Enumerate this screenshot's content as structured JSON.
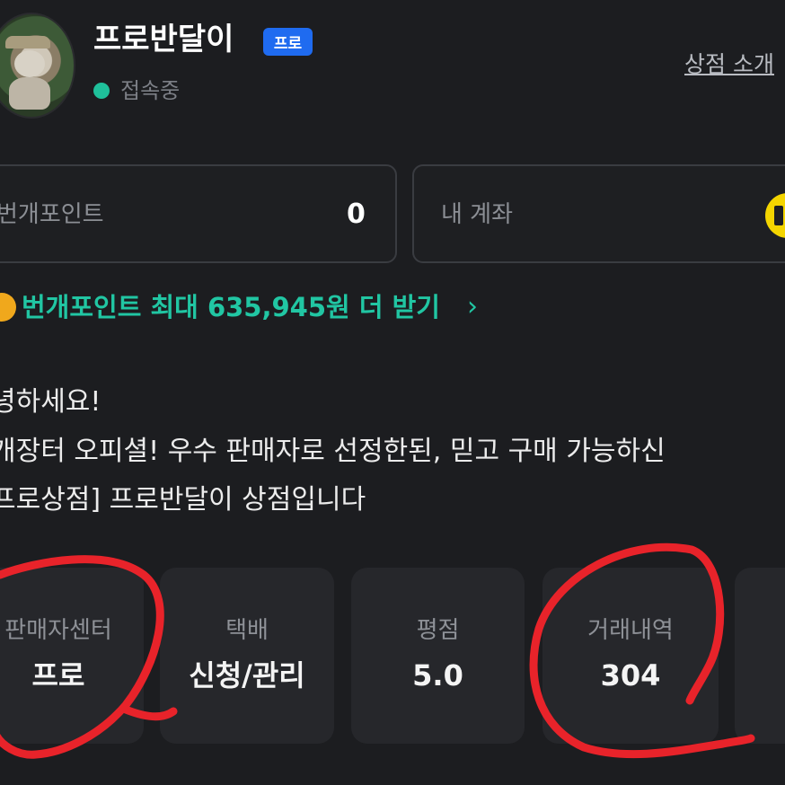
{
  "header": {
    "shop_name": "프로반달이",
    "badge": "프로",
    "status": "접속중",
    "shop_intro_link": "상점 소개"
  },
  "wallet": {
    "points_label": "번개포인트",
    "points_value": "0",
    "account_label": "내 계좌"
  },
  "promo": {
    "text": "번개포인트 최대 635,945원 더 받기",
    "chevron": "›"
  },
  "intro_lines": [
    "녕하세요!",
    "개장터 오피셜! 우수 판매자로 선정한된, 믿고 구매 가능하신",
    "프로상점] 프로반달이 상점입니다"
  ],
  "stats": [
    {
      "label": "판매자센터",
      "value": "프로"
    },
    {
      "label": "택배",
      "value": "신청/관리"
    },
    {
      "label": "평점",
      "value": "5.0"
    },
    {
      "label": "거래내역",
      "value": "304"
    }
  ],
  "colors": {
    "background": "#1c1d20",
    "accent_green": "#21c6a3",
    "online_green": "#1fc09b",
    "badge_blue": "#1f6bf0",
    "annotation_red": "#e8232a",
    "account_yellow": "#f4d500"
  },
  "icons": {
    "avatar": "teddy-bear-photo",
    "status_dot": "online-dot-icon",
    "coin": "coin-icon",
    "account": "account-icon"
  }
}
